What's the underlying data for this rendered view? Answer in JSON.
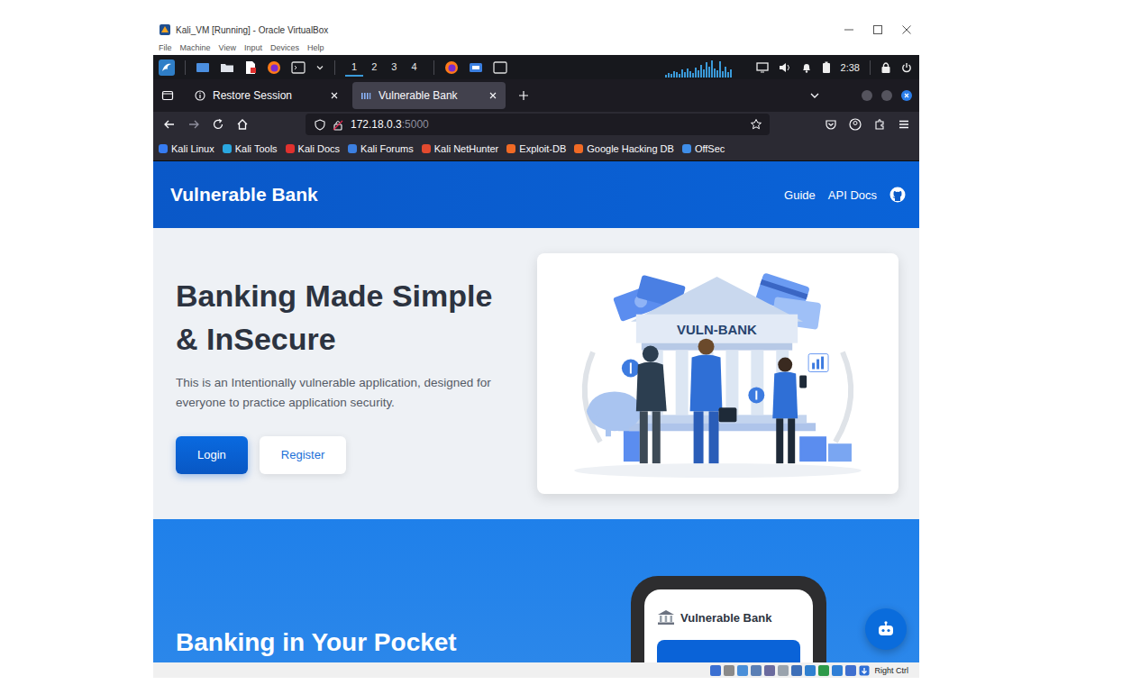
{
  "window": {
    "title": "Kali_VM [Running] - Oracle VirtualBox"
  },
  "menu": [
    "File",
    "Machine",
    "View",
    "Input",
    "Devices",
    "Help"
  ],
  "panel": {
    "workspaces": [
      {
        "label": "1",
        "selected": true
      },
      {
        "label": "2",
        "selected": false
      },
      {
        "label": "3",
        "selected": false
      },
      {
        "label": "4",
        "selected": false
      }
    ],
    "activity": [
      0.15,
      0.25,
      0.2,
      0.35,
      0.3,
      0.2,
      0.45,
      0.3,
      0.5,
      0.35,
      0.25,
      0.55,
      0.4,
      0.7,
      0.45,
      0.85,
      0.6,
      0.95,
      0.5,
      0.4,
      0.9,
      0.35,
      0.6,
      0.3,
      0.45
    ],
    "clock": "2:38"
  },
  "browser": {
    "tabs": [
      {
        "label": "Restore Session",
        "selected": false
      },
      {
        "label": "Vulnerable Bank",
        "selected": true
      }
    ],
    "url": {
      "host": "172.18.0.3",
      "port": ":5000"
    },
    "bookmarks": [
      {
        "label": "Kali Linux",
        "color": "#367bf0"
      },
      {
        "label": "Kali Tools",
        "color": "#2aa7e0"
      },
      {
        "label": "Kali Docs",
        "color": "#e0312e"
      },
      {
        "label": "Kali Forums",
        "color": "#3c7fe0"
      },
      {
        "label": "Kali NetHunter",
        "color": "#e24a2f"
      },
      {
        "label": "Exploit-DB",
        "color": "#f06a25"
      },
      {
        "label": "Google Hacking DB",
        "color": "#f06a25"
      },
      {
        "label": "OffSec",
        "color": "#3f8ee8"
      }
    ]
  },
  "page": {
    "brand": "Vulnerable Bank",
    "nav": [
      "Guide",
      "API Docs"
    ],
    "hero": {
      "title_lines": [
        "Banking Made Simple",
        "& InSecure"
      ],
      "text": "This is an Intentionally vulnerable application, designed for everyone to practice application security.",
      "buttons": [
        "Login",
        "Register"
      ],
      "sign": "VULN-BANK"
    },
    "section": {
      "heading": "Banking in Your Pocket",
      "phone_title": "Vulnerable Bank"
    }
  },
  "status_bar": {
    "host_key": "Right Ctrl"
  }
}
